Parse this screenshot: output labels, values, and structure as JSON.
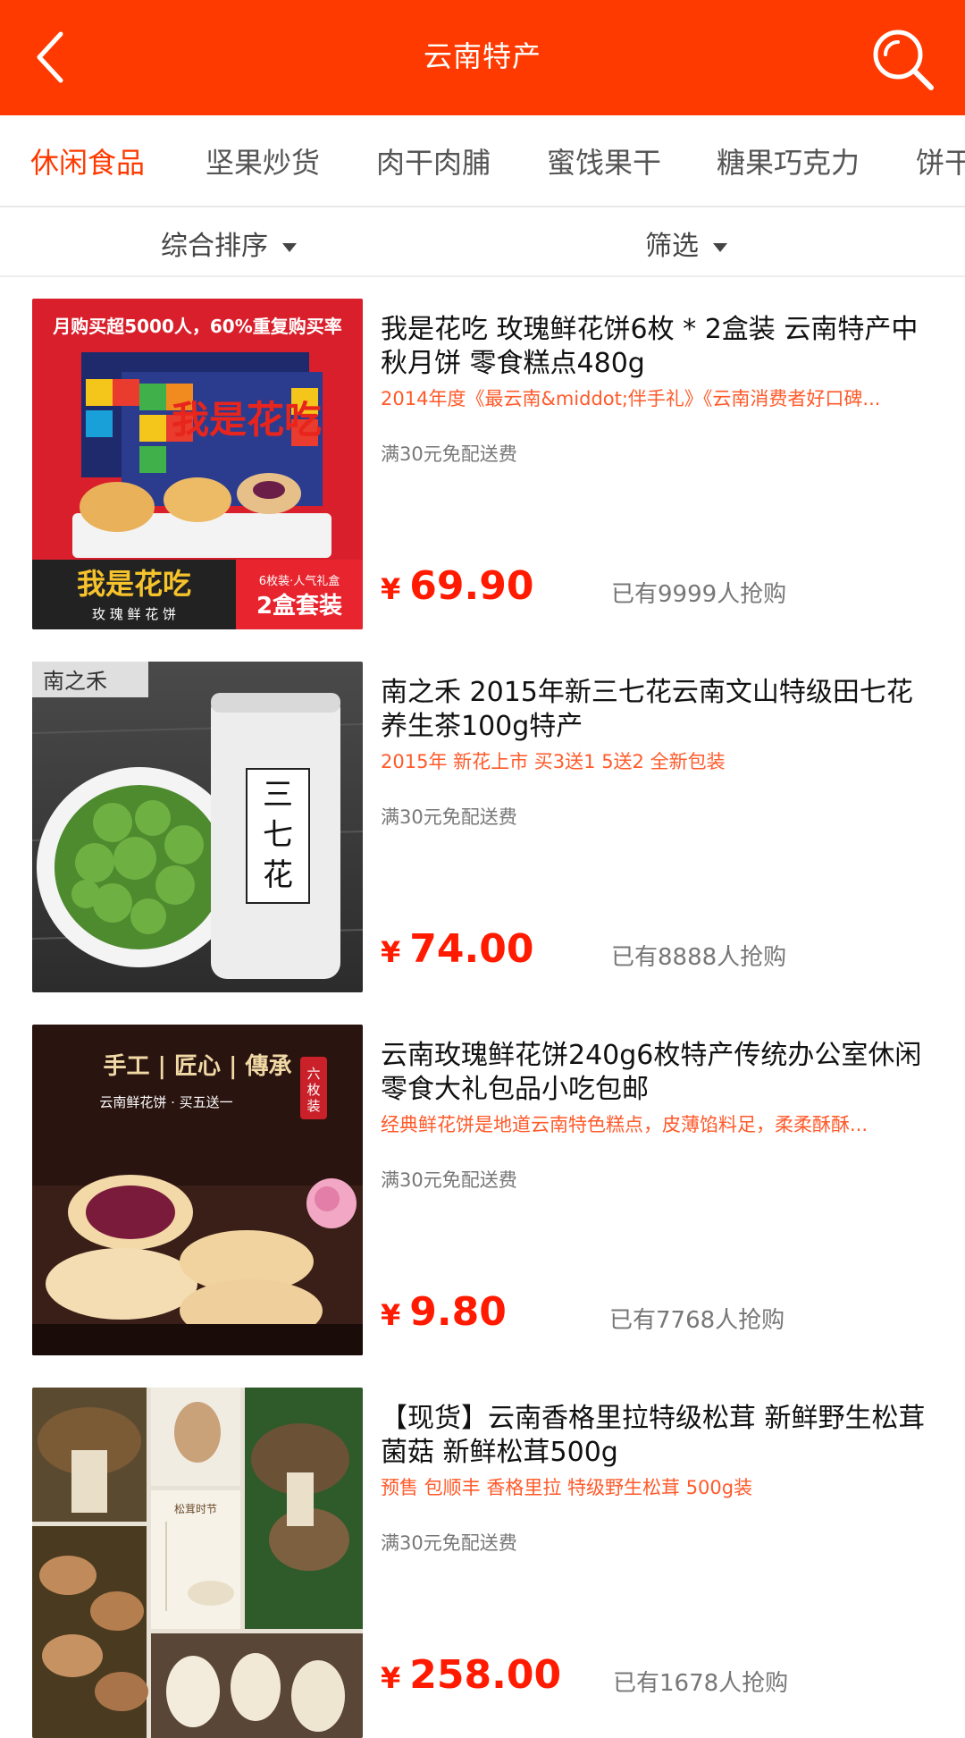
{
  "header": {
    "title": "云南特产",
    "bg_color": "#FF3A00"
  },
  "tabs": [
    {
      "label": "休闲食品",
      "active": true
    },
    {
      "label": "坚果炒货",
      "active": false
    },
    {
      "label": "肉干肉脯",
      "active": false
    },
    {
      "label": "蜜饯果干",
      "active": false
    },
    {
      "label": "糖果巧克力",
      "active": false
    },
    {
      "label": "饼干",
      "active": false
    }
  ],
  "sort": {
    "composite_label": "综合排序",
    "filter_label": "筛选"
  },
  "products": [
    {
      "name": "我是花吃 玫瑰鲜花饼6枚 * 2盒装 云南特产中秋月饼 零食糕点480g",
      "desc": "2014年度《最云南&middot;伴手礼》《云南消费者好口碑...",
      "shipping": "满30元免配送费",
      "currency": "¥",
      "price": "69.90",
      "sold": "已有9999人抢购",
      "image": {
        "banner": "月购买超5000人，60%重复购买率",
        "brand": "我是花吃",
        "sub": "玫 瑰 鲜 花 饼",
        "tag1": "6枚装·人气礼盒",
        "tag2": "2盒套装"
      }
    },
    {
      "name": "南之禾 2015年新三七花云南文山特级田七花养生茶100g特产",
      "desc": "2015年 新花上市 买3送1 5送2 全新包装",
      "shipping": "满30元免配送费",
      "currency": "¥",
      "price": "74.00",
      "sold": "已有8888人抢购",
      "image": {
        "brand": "南之禾",
        "can_text": "三七花"
      }
    },
    {
      "name": "云南玫瑰鲜花饼240g6枚特产传统办公室休闲零食大礼包品小吃包邮",
      "desc": "经典鲜花饼是地道云南特色糕点，皮薄馅料足，柔柔酥酥...",
      "shipping": "满30元免配送费",
      "currency": "¥",
      "price": "9.80",
      "sold": "已有7768人抢购",
      "image": {
        "headline": "手工 | 匠心 | 傳承",
        "sub": "云南鲜花饼 · 买五送一",
        "seal": "六枚装"
      }
    },
    {
      "name": "【现货】云南香格里拉特级松茸 新鲜野生松茸菌菇 新鲜松茸500g",
      "desc": "预售 包顺丰 香格里拉 特级野生松茸 500g装",
      "shipping": "满30元免配送费",
      "currency": "¥",
      "price": "258.00",
      "sold": "已有1678人抢购",
      "image": {
        "poem_title": "松茸时节",
        "poem": "一年好景君须记 最是松茸歌上时"
      }
    }
  ]
}
